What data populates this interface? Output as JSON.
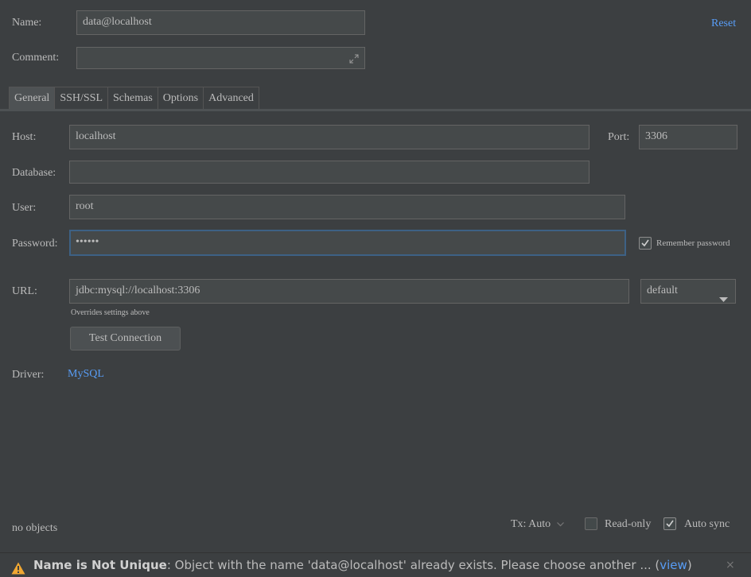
{
  "header": {
    "name_label": "Name:",
    "name_value": "data@localhost",
    "comment_label": "Comment:",
    "comment_value": "",
    "reset_label": "Reset"
  },
  "tabs": [
    {
      "label": "General",
      "selected": true
    },
    {
      "label": "SSH/SSL",
      "selected": false
    },
    {
      "label": "Schemas",
      "selected": false
    },
    {
      "label": "Options",
      "selected": false
    },
    {
      "label": "Advanced",
      "selected": false
    }
  ],
  "general": {
    "host_label": "Host:",
    "host_value": "localhost",
    "port_label": "Port:",
    "port_value": "3306",
    "database_label": "Database:",
    "database_value": "",
    "user_label": "User:",
    "user_value": "root",
    "password_label": "Password:",
    "password_value": "••••••",
    "remember_password_label": "Remember password",
    "remember_password_checked": true,
    "url_label": "URL:",
    "url_value": "jdbc:mysql://localhost:3306",
    "url_hint": "Overrides settings above",
    "url_mode_value": "default",
    "test_connection_label": "Test Connection",
    "driver_label": "Driver:",
    "driver_value": "MySQL"
  },
  "footer": {
    "objects_text": "no objects",
    "tx_label": "Tx: Auto",
    "readonly_label": "Read-only",
    "readonly_checked": false,
    "autosync_label": "Auto sync",
    "autosync_checked": true
  },
  "notification": {
    "title": "Name is Not Unique",
    "message": ": Object with the name 'data@localhost' already exists. Please choose another ... (",
    "link": "view",
    "close_after": ")",
    "icon": "warning-icon",
    "icon_color": "#f0a732"
  },
  "colors": {
    "background": "#3c3f41",
    "field_bg": "#45494a",
    "link": "#589df6",
    "focus_border": "#3d6185"
  }
}
